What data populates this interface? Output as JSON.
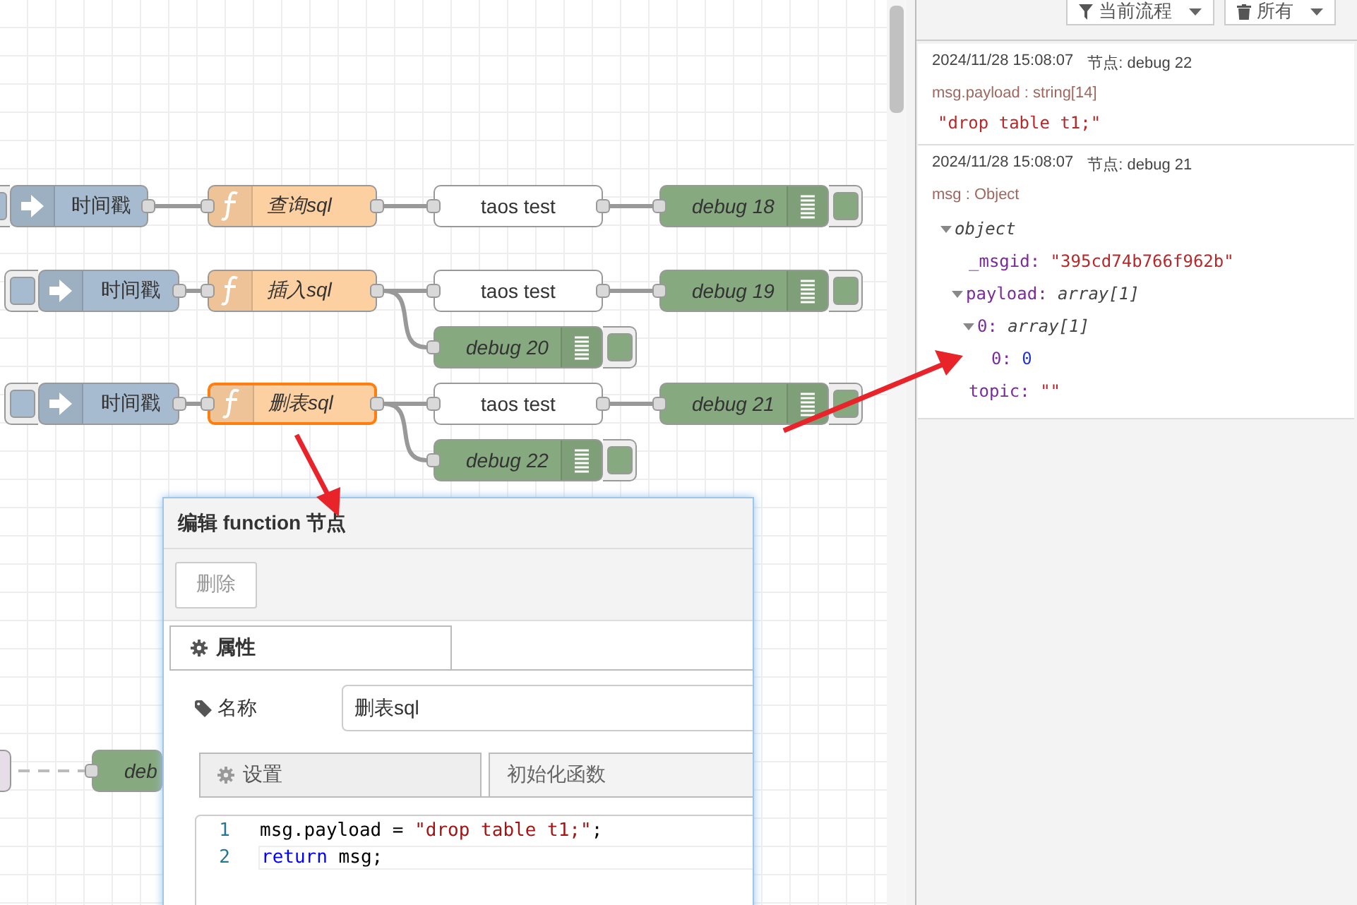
{
  "flow": {
    "nodes": [
      {
        "kind": "inject",
        "label": "时间戳"
      },
      {
        "kind": "function",
        "label": "查询sql",
        "selected": false
      },
      {
        "kind": "sink",
        "label": "taos test"
      },
      {
        "kind": "debug",
        "label": "debug 18"
      },
      {
        "kind": "inject",
        "label": "时间戳"
      },
      {
        "kind": "function",
        "label": "插入sql",
        "selected": false
      },
      {
        "kind": "sink",
        "label": "taos test"
      },
      {
        "kind": "debug",
        "label": "debug 19"
      },
      {
        "kind": "debug",
        "label": "debug 20"
      },
      {
        "kind": "inject",
        "label": "时间戳"
      },
      {
        "kind": "function",
        "label": "删表sql",
        "selected": true
      },
      {
        "kind": "sink",
        "label": "taos test"
      },
      {
        "kind": "debug",
        "label": "debug 21"
      },
      {
        "kind": "debug",
        "label": "debug 22"
      },
      {
        "kind": "plain"
      },
      {
        "kind": "debug",
        "label": "deb"
      }
    ]
  },
  "dialog": {
    "title": "编辑 function 节点",
    "buttons": [
      "删除"
    ],
    "tabs": [
      {
        "label": "属性",
        "selected": true
      }
    ],
    "name_field": {
      "label": "名称",
      "value": "删表sql"
    },
    "subtabs": [
      {
        "label": "设置",
        "selected": true
      },
      {
        "label": "初始化函数",
        "selected": false
      }
    ],
    "code": [
      {
        "number": "1",
        "active": false,
        "tokens": [
          {
            "text": "msg.payload = ",
            "kind": "plain"
          },
          {
            "text": "\"drop table t1;\"",
            "kind": "string"
          },
          {
            "text": ";",
            "kind": "plain"
          }
        ]
      },
      {
        "number": "2",
        "active": true,
        "tokens": [
          {
            "text": "return",
            "kind": "keyword"
          },
          {
            "text": " msg;",
            "kind": "plain"
          }
        ]
      }
    ]
  },
  "debug_panel": {
    "filters": [
      {
        "label": "当前流程"
      },
      {
        "label": "所有"
      }
    ],
    "messages": [
      {
        "time": "2024/11/28 15:08:07",
        "node": "节点: debug 22",
        "meta": "msg.payload : string[14]",
        "kind": "string",
        "value": "\"drop table t1;\""
      },
      {
        "time": "2024/11/28 15:08:07",
        "node": "节点: debug 21",
        "meta": "msg : Object",
        "kind": "object",
        "tree": {
          "label": "object",
          "expanded": true,
          "children": [
            {
              "key": "_msgid:",
              "kind": "string",
              "value": "\"395cd74b766f962b\""
            },
            {
              "key": "payload:",
              "type": "array[1]",
              "expanded": true,
              "children": [
                {
                  "key": "0:",
                  "type": "array[1]",
                  "expanded": true,
                  "children": [
                    {
                      "key": "0:",
                      "kind": "number",
                      "value": "0"
                    }
                  ]
                }
              ]
            },
            {
              "key": "topic:",
              "kind": "string",
              "value": "\"\""
            }
          ]
        }
      }
    ]
  }
}
